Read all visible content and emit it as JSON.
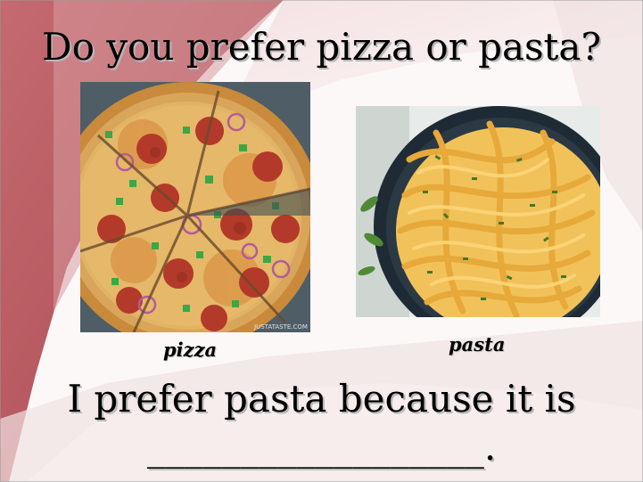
{
  "slide": {
    "title": "Do you prefer pizza or pasta?",
    "images": [
      {
        "label": "pizza",
        "icon": "pizza-photo"
      },
      {
        "label": "pasta",
        "icon": "pasta-photo"
      }
    ],
    "prompt": "I prefer pasta because it is",
    "blank": "__________________."
  },
  "colors": {
    "background": "#fbf7f7",
    "accent_red": "#b3555c",
    "text": "#000000"
  }
}
